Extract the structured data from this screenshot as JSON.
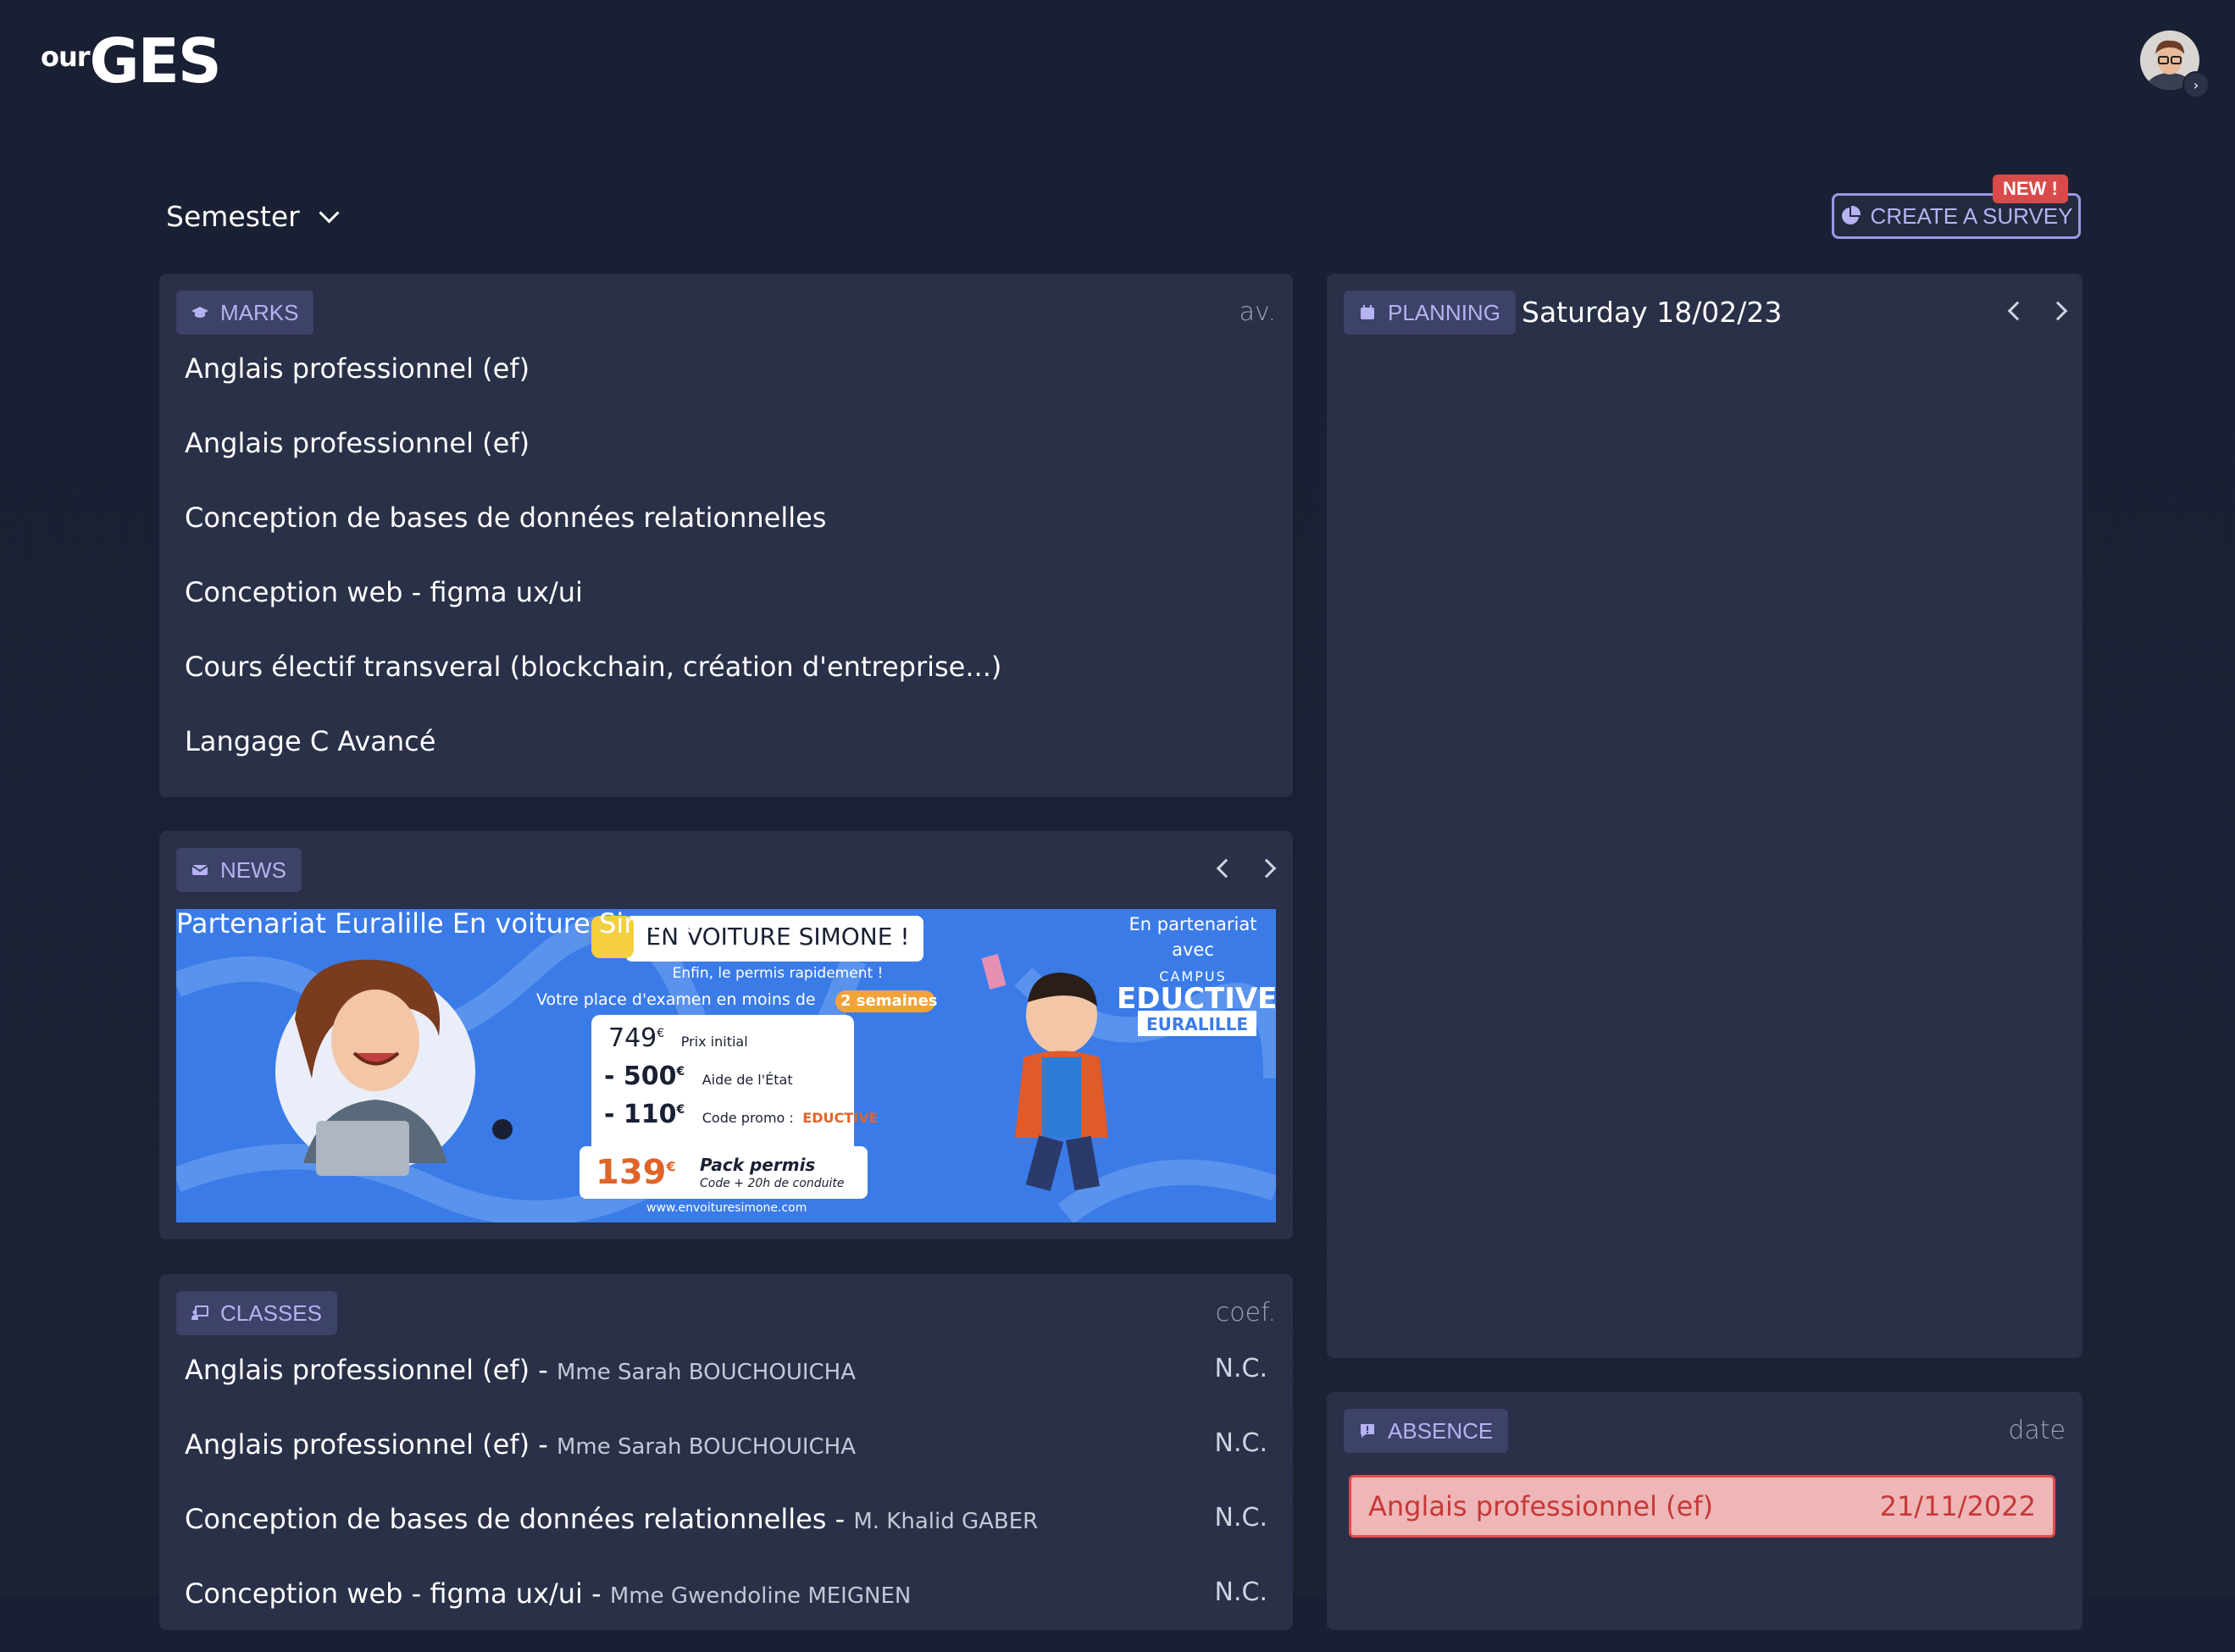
{
  "app": {
    "logo_small": "our",
    "logo_big": "GES"
  },
  "header": {
    "semester_label": "Semester",
    "survey_button": "CREATE A SURVEY",
    "new_badge": "NEW !"
  },
  "marks": {
    "chip_label": "MARKS",
    "corner_label": "av.",
    "items": [
      "Anglais professionnel (ef)",
      "Anglais professionnel (ef)",
      "Conception de bases de données relationnelles",
      "Conception web - figma ux/ui",
      "Cours électif transveral (blockchain, création d'entreprise...)",
      "Langage C Avancé"
    ]
  },
  "planning": {
    "chip_label": "PLANNING",
    "date": "Saturday 18/02/23"
  },
  "news": {
    "chip_label": "NEWS",
    "title": "Partenariat Euralille En voiture Simone",
    "banner": {
      "headline": "EN VOITURE SIMONE !",
      "tagline": "Enfin, le permis rapidement !",
      "exam_text": "Votre place d'examen en moins de",
      "exam_weeks": "2 semaines",
      "price_initial": "749",
      "price_initial_label": "Prix initial",
      "aid": "- 500",
      "aid_label": "Aide de l'État",
      "promo": "- 110",
      "promo_label": "Code promo :",
      "promo_code": "EDUCTIVE",
      "pack_price": "139",
      "pack_label": "Pack permis",
      "pack_sub": "Code + 20h de conduite",
      "website": "www.envoituresimone.com",
      "partner_1": "En partenariat",
      "partner_2": "avec",
      "campus": "CAMPUS",
      "eductive": "EDUCTIVE",
      "euralille": "EURALILLE",
      "currency": "€"
    }
  },
  "classes": {
    "chip_label": "CLASSES",
    "corner_label": "coef.",
    "items": [
      {
        "name": "Anglais professionnel (ef) - ",
        "teacher": "Mme Sarah BOUCHOUICHA",
        "coef": "N.C."
      },
      {
        "name": "Anglais professionnel (ef) - ",
        "teacher": "Mme Sarah BOUCHOUICHA",
        "coef": "N.C."
      },
      {
        "name": "Conception de bases de données relationnelles - ",
        "teacher": "M. Khalid GABER",
        "coef": "N.C."
      },
      {
        "name": "Conception web - figma ux/ui - ",
        "teacher": "Mme Gwendoline MEIGNEN",
        "coef": "N.C."
      }
    ]
  },
  "absence": {
    "chip_label": "ABSENCE",
    "corner_label": "date",
    "items": [
      {
        "course": "Anglais professionnel (ef)",
        "date": "21/11/2022"
      }
    ]
  },
  "colors": {
    "background": "#1a2033",
    "card": "#293047",
    "chip": "#3d4268",
    "accent": "#b7b2f2",
    "alert": "#e24b4b",
    "banner": "#3a7be8"
  }
}
